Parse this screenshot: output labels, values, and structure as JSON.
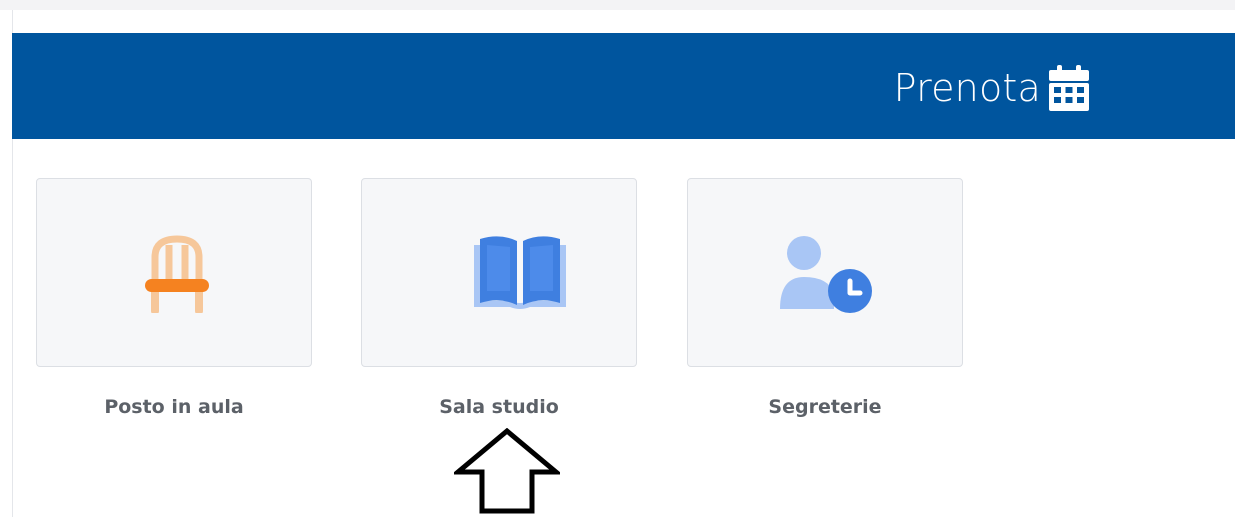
{
  "header": {
    "title": "Prenota",
    "icon": "calendar-icon",
    "background": "#00559e"
  },
  "services": [
    {
      "label": "Posto in aula",
      "icon": "chair-icon",
      "color": "#f58220"
    },
    {
      "label": "Sala studio",
      "icon": "open-book-icon",
      "color": "#3f7fe0"
    },
    {
      "label": "Segreterie",
      "icon": "user-clock-icon",
      "color": "#3f7fe0"
    }
  ],
  "annotation": {
    "icon": "up-arrow-icon",
    "points_to": "Sala studio"
  }
}
